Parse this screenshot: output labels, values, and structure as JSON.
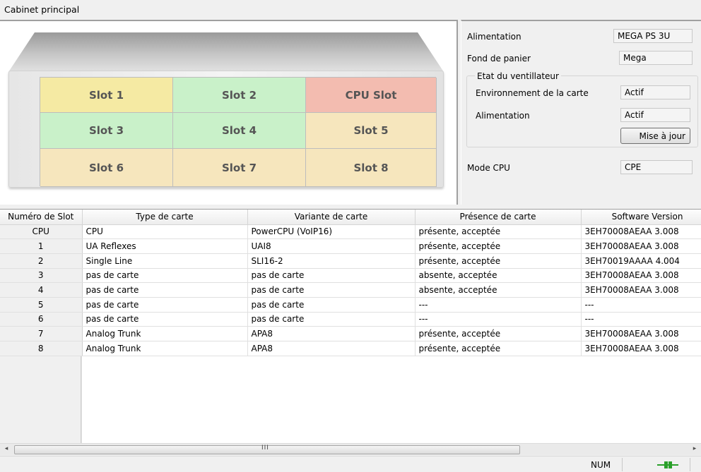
{
  "window": {
    "title": "Cabinet principal"
  },
  "cabinet": {
    "slots": [
      {
        "label": "Slot 1",
        "color": "#f5eaa3"
      },
      {
        "label": "Slot 2",
        "color": "#c9f1c9"
      },
      {
        "label": "CPU Slot",
        "color": "#f3bcb0"
      },
      {
        "label": "Slot 3",
        "color": "#c9f1c9"
      },
      {
        "label": "Slot 4",
        "color": "#c9f1c9"
      },
      {
        "label": "Slot 5",
        "color": "#f6e6bd"
      },
      {
        "label": "Slot 6",
        "color": "#f6e6bd"
      },
      {
        "label": "Slot 7",
        "color": "#f6e6bd"
      },
      {
        "label": "Slot 8",
        "color": "#f6e6bd"
      }
    ]
  },
  "info": {
    "alimentation": {
      "label": "Alimentation",
      "value": "MEGA PS 3U"
    },
    "fond_de_panier": {
      "label": "Fond de panier",
      "value": "Mega"
    },
    "ventilateur": {
      "legend": "Etat du ventillateur",
      "environnement": {
        "label": "Environnement de la carte",
        "value": "Actif"
      },
      "alimentation": {
        "label": "Alimentation",
        "value": "Actif"
      },
      "update_button": "Mise à jour"
    },
    "mode_cpu": {
      "label": "Mode CPU",
      "value": "CPE"
    }
  },
  "table": {
    "columns": [
      "Numéro de Slot",
      "Type de carte",
      "Variante de carte",
      "Présence de carte",
      "Software Version"
    ],
    "rows": [
      [
        "CPU",
        "CPU",
        "PowerCPU (VoIP16)",
        "présente, acceptée",
        "3EH70008AEAA 3.008"
      ],
      [
        "1",
        "UA Reflexes",
        "UAI8",
        "présente, acceptée",
        "3EH70008AEAA 3.008"
      ],
      [
        "2",
        "Single Line",
        "SLI16-2",
        "présente, acceptée",
        "3EH70019AAAA 4.004"
      ],
      [
        "3",
        "pas de carte",
        "pas de carte",
        "absente, acceptée",
        "3EH70008AEAA 3.008"
      ],
      [
        "4",
        "pas de carte",
        "pas de carte",
        "absente, acceptée",
        "3EH70008AEAA 3.008"
      ],
      [
        "5",
        "pas de carte",
        "pas de carte",
        "---",
        "---"
      ],
      [
        "6",
        "pas de carte",
        "pas de carte",
        "---",
        "---"
      ],
      [
        "7",
        "Analog Trunk",
        "APA8",
        "présente, acceptée",
        "3EH70008AEAA 3.008"
      ],
      [
        "8",
        "Analog Trunk",
        "APA8",
        "présente, acceptée",
        "3EH70008AEAA 3.008"
      ]
    ]
  },
  "scrollbar": {
    "left_arrow": "◂",
    "right_arrow": "▸",
    "grip": "III"
  },
  "statusbar": {
    "num": "NUM",
    "icon": "connection-icon"
  }
}
